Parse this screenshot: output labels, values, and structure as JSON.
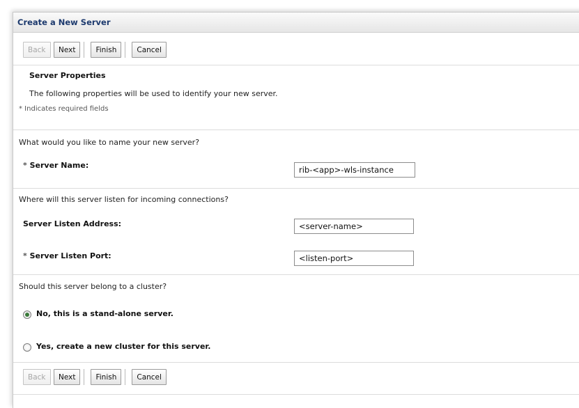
{
  "panel": {
    "title": "Create a New Server"
  },
  "buttons": {
    "back": "Back",
    "next": "Next",
    "finish": "Finish",
    "cancel": "Cancel"
  },
  "section": {
    "heading": "Server Properties",
    "description": "The following properties will be used to identify your new server.",
    "required_note": "* Indicates required fields"
  },
  "name_group": {
    "question": "What would you like to name your new server?",
    "server_name_label": "Server Name:",
    "server_name_value": "rib-<app>-wls-instance"
  },
  "listen_group": {
    "question": "Where will this server listen for incoming connections?",
    "address_label": "Server Listen Address:",
    "address_value": "<server-name>",
    "port_label": "Server Listen Port:",
    "port_value": "<listen-port>"
  },
  "cluster_group": {
    "question": "Should this server belong to a cluster?",
    "option_standalone": "No, this is a stand-alone server.",
    "option_new_cluster": "Yes, create a new cluster for this server.",
    "selected": "standalone"
  },
  "required_marker": "*"
}
